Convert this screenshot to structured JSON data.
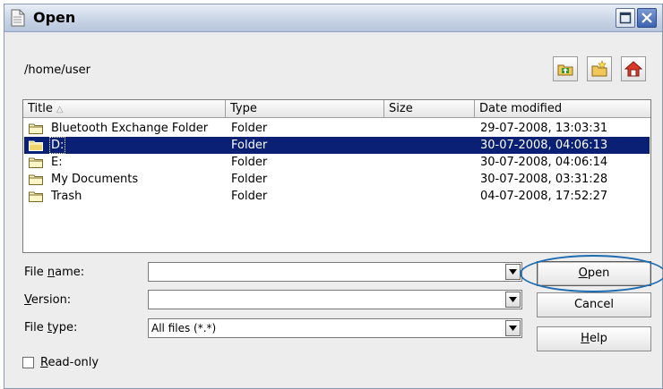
{
  "window": {
    "title": "Open"
  },
  "location": {
    "path": "/home/user"
  },
  "toolbar": {
    "up_icon": "up-folder-icon",
    "new_folder_icon": "new-folder-icon",
    "home_icon": "home-icon"
  },
  "file_list": {
    "columns": [
      "Title",
      "Type",
      "Size",
      "Date modified"
    ],
    "sort_indicator": "△",
    "rows": [
      {
        "name": "Bluetooth Exchange Folder",
        "type": "Folder",
        "size": "",
        "date": "29-07-2008, 13:03:31",
        "selected": false
      },
      {
        "name": "D:",
        "type": "Folder",
        "size": "",
        "date": "30-07-2008, 04:06:13",
        "selected": true
      },
      {
        "name": "E:",
        "type": "Folder",
        "size": "",
        "date": "30-07-2008, 04:06:14",
        "selected": false
      },
      {
        "name": "My Documents",
        "type": "Folder",
        "size": "",
        "date": "30-07-2008, 03:31:28",
        "selected": false
      },
      {
        "name": "Trash",
        "type": "Folder",
        "size": "",
        "date": "04-07-2008, 17:52:27",
        "selected": false
      }
    ]
  },
  "form": {
    "file_name_label_pre": "File ",
    "file_name_label_key": "n",
    "file_name_label_post": "ame:",
    "file_name_value": "",
    "version_label_key": "V",
    "version_label_post": "ersion:",
    "version_value": "",
    "file_type_label_pre": "File ",
    "file_type_label_key": "t",
    "file_type_label_post": "ype:",
    "file_type_value": "All files (*.*)",
    "read_only_key": "R",
    "read_only_post": "ead-only",
    "read_only_checked": false
  },
  "buttons": {
    "open_key": "O",
    "open_post": "pen",
    "cancel": "Cancel",
    "help_key": "H",
    "help_post": "elp"
  },
  "colors": {
    "selection": "#0a2075",
    "highlight_ellipse": "#1e6bb0"
  }
}
